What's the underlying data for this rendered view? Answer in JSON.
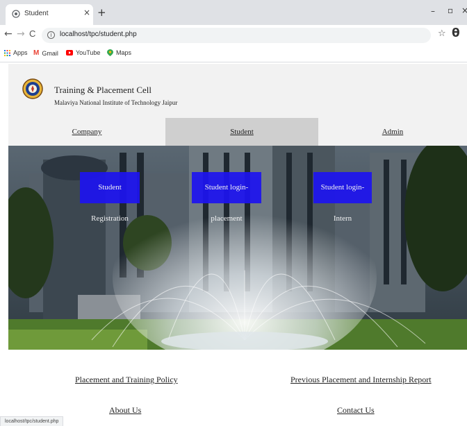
{
  "browser": {
    "tab_title": "Student",
    "tab_close": "×",
    "new_tab": "+",
    "url": "localhost/tpc/student.php",
    "status_url": "localhost/tpc/student.php",
    "nav_icons": {
      "back": "←",
      "forward": "→",
      "reload": "C"
    },
    "window_controls": {
      "minimize": "–",
      "restore": "▫",
      "close": "×"
    },
    "bookmark_star": "☆",
    "profile_icon": "θ",
    "bookmarks": [
      {
        "label": "Apps",
        "icon": "apps-grid-icon"
      },
      {
        "label": "Gmail",
        "icon": "gmail-icon"
      },
      {
        "label": "YouTube",
        "icon": "youtube-icon"
      },
      {
        "label": "Maps",
        "icon": "maps-icon"
      }
    ]
  },
  "site": {
    "org_name": "Training & Placement Cell",
    "org_sub": "Malaviya National Institute of Technology Jaipur",
    "nav": [
      {
        "label": "Company",
        "active": false
      },
      {
        "label": "Student",
        "active": true
      },
      {
        "label": "Admin",
        "active": false
      }
    ],
    "hero_buttons": [
      "Student Registration",
      "Student login-placement",
      "Student login-Intern"
    ],
    "footer_links": [
      "Placement and Training Policy",
      "Previous Placement and Internship Report",
      "About Us",
      "Contact Us"
    ]
  },
  "colors": {
    "hero_button_bg": "#1d14f0",
    "active_nav_bg": "#cfcfcf",
    "header_bg": "#f2f2f2"
  }
}
